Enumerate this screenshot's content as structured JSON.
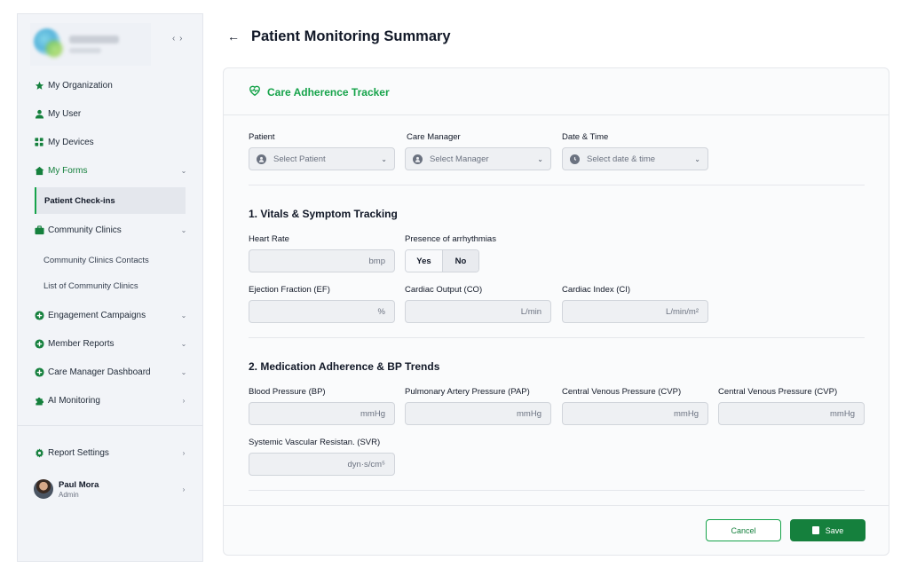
{
  "sidebar": {
    "items": [
      {
        "label": "My Organization",
        "icon": "star-icon"
      },
      {
        "label": "My User",
        "icon": "user-icon"
      },
      {
        "label": "My Devices",
        "icon": "grid-icon"
      },
      {
        "label": "My Forms",
        "icon": "home-icon",
        "chevron": "⌄"
      },
      {
        "label": "Community Clinics",
        "icon": "briefcase-icon",
        "chevron": "⌄"
      },
      {
        "label": "Engagement Campaigns",
        "icon": "plus-circle-icon",
        "chevron": "⌄"
      },
      {
        "label": "Member Reports",
        "icon": "plus-circle-icon",
        "chevron": "⌄"
      },
      {
        "label": "Care Manager Dashboard",
        "icon": "plus-circle-icon",
        "chevron": "⌄"
      },
      {
        "label": "AI Monitoring",
        "icon": "puzzle-icon",
        "chevron": "›"
      }
    ],
    "subitems": {
      "patient_checkins": "Patient Check-ins",
      "clinics_contacts": "Community Clinics Contacts",
      "clinics_list": "List of Community Clinics"
    },
    "report_settings": "Report Settings",
    "report_settings_chevron": "›",
    "user": {
      "name": "Paul Mora",
      "role": "Admin",
      "chevron": "›"
    },
    "collapse_glyph": "‹ ›",
    "accent": "#16a34a"
  },
  "header": {
    "back_glyph": "←",
    "title": "Patient Monitoring Summary"
  },
  "card": {
    "title": "Care Adherence Tracker"
  },
  "form": {
    "patient": {
      "label": "Patient",
      "placeholder": "Select Patient"
    },
    "manager": {
      "label": "Care Manager",
      "placeholder": "Select Manager"
    },
    "datetime": {
      "label": "Date & Time",
      "placeholder": "Select date & time"
    },
    "chevron": "⌄"
  },
  "section1": {
    "title": "1. Vitals & Symptom Tracking",
    "heart_rate": {
      "label": "Heart Rate",
      "unit": "bmp"
    },
    "arrhythmias": {
      "label": "Presence of arrhythmias",
      "yes": "Yes",
      "no": "No"
    },
    "ef": {
      "label": "Ejection Fraction (EF)",
      "unit": "%"
    },
    "co": {
      "label": "Cardiac Output (CO)",
      "unit": "L/min"
    },
    "ci": {
      "label": "Cardiac Index (CI)",
      "unit": "L/min/m²"
    }
  },
  "section2": {
    "title": "2. Medication Adherence & BP Trends",
    "bp": {
      "label": "Blood Pressure (BP)",
      "unit": "mmHg"
    },
    "pap": {
      "label": "Pulmonary Artery Pressure (PAP)",
      "unit": "mmHg"
    },
    "cvp1": {
      "label": "Central Venous Pressure (CVP)",
      "unit": "mmHg"
    },
    "cvp2": {
      "label": "Central Venous Pressure (CVP)",
      "unit": "mmHg"
    },
    "svr": {
      "label": "Systemic Vascular Resistan. (SVR)",
      "unit": "dyn·s/cm⁵"
    }
  },
  "actions": {
    "cancel": "Cancel",
    "save": "Save"
  }
}
